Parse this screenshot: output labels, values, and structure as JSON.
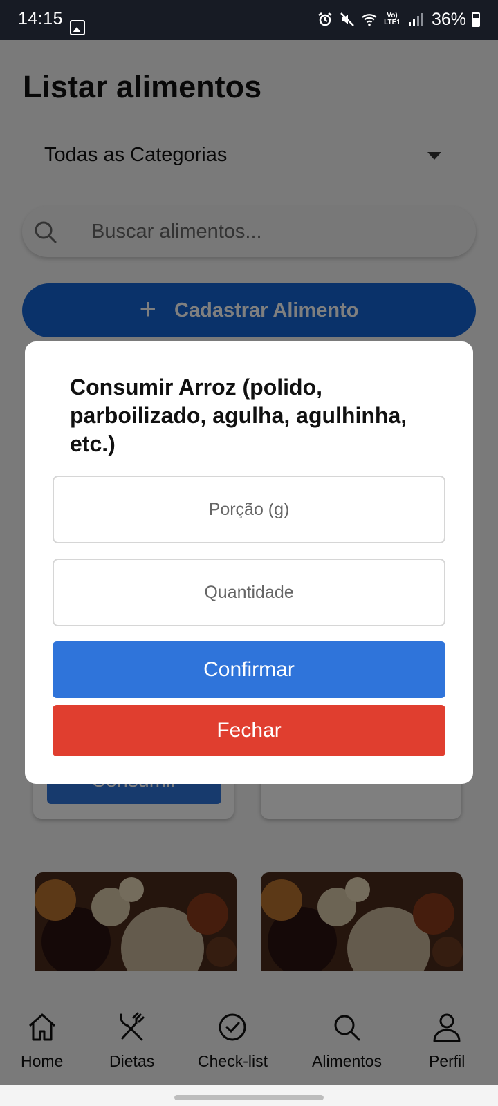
{
  "status_bar": {
    "time": "14:15",
    "network_label": "Vo) LTE1",
    "battery": "36%",
    "icons": [
      "gallery-icon",
      "alarm-icon",
      "mute-icon",
      "wifi-icon",
      "signal-icon",
      "battery-icon"
    ]
  },
  "page": {
    "title": "Listar alimentos",
    "category": "Todas as Categorias",
    "search_placeholder": "Buscar alimentos...",
    "add_button": "Cadastrar Alimento"
  },
  "cards": {
    "consume_label": "Consumir"
  },
  "modal": {
    "title": "Consumir Arroz (polido, parboilizado, agulha, agulhinha, etc.)",
    "portion_placeholder": "Porção (g)",
    "quantity_placeholder": "Quantidade",
    "confirm": "Confirmar",
    "close": "Fechar",
    "colors": {
      "confirm": "#2f74da",
      "close": "#e03e2f"
    }
  },
  "bottom_nav": [
    {
      "label": "Home",
      "icon": "home-icon"
    },
    {
      "label": "Dietas",
      "icon": "utensils-icon"
    },
    {
      "label": "Check-list",
      "icon": "check-circle-icon"
    },
    {
      "label": "Alimentos",
      "icon": "search-icon"
    },
    {
      "label": "Perfil",
      "icon": "user-icon"
    }
  ],
  "colors": {
    "primary": "#1564d4",
    "overlay": "rgba(0,0,0,0.5)"
  }
}
